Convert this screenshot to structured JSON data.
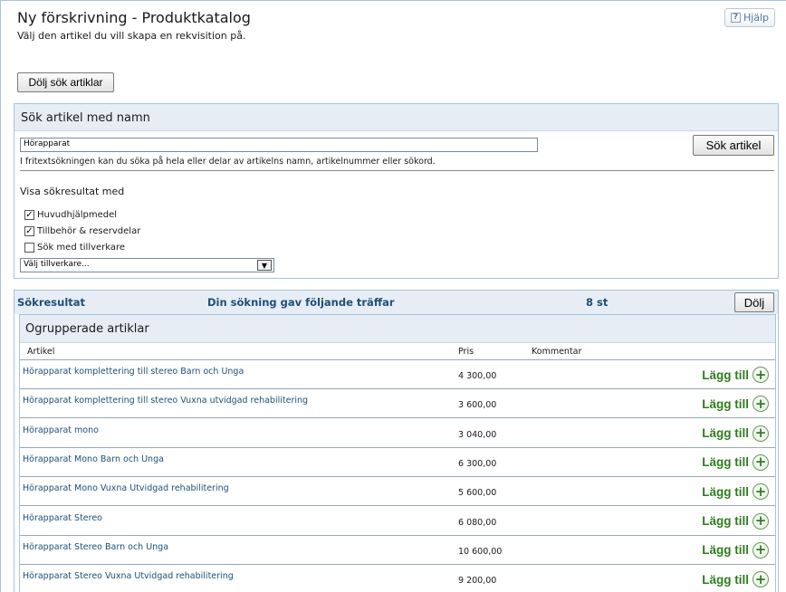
{
  "header": {
    "title": "Ny förskrivning - Produktkatalog",
    "subtitle": "Välj den artikel du vill skapa en rekvisition på.",
    "help_label": "Hjälp"
  },
  "toolbar": {
    "hide_search_label": "Dölj sök artiklar"
  },
  "search": {
    "panel_title": "Sök artikel med namn",
    "input_value": "Hörapparat",
    "search_button": "Sök artikel",
    "hint": "I fritextsökningen kan du söka på hela eller delar av artikelns namn, artikelnummer eller sökord.",
    "show_results_label": "Visa sökresultat med",
    "options": [
      {
        "label": "Huvudhjälpmedel",
        "checked": true
      },
      {
        "label": "Tillbehör & reservdelar",
        "checked": true
      },
      {
        "label": "Sök med tillverkare",
        "checked": false
      }
    ],
    "manufacturer_select": "Välj tillverkare..."
  },
  "results": {
    "title": "Sökresultat",
    "message": "Din sökning gav följande träffar",
    "count": "8 st",
    "hide_label": "Dölj",
    "group_title": "Ogrupperade artiklar",
    "columns": [
      "Artikel",
      "Pris",
      "Kommentar"
    ],
    "add_label": "Lägg till",
    "rows": [
      {
        "name": "Hörapparat komplettering till stereo Barn och Unga",
        "price": "4 300,00"
      },
      {
        "name": "Hörapparat komplettering till stereo Vuxna utvidgad rehabilitering",
        "price": "3 600,00"
      },
      {
        "name": "Hörapparat mono",
        "price": "3 040,00"
      },
      {
        "name": "Hörapparat Mono Barn och Unga",
        "price": "6 300,00"
      },
      {
        "name": "Hörapparat Mono Vuxna Utvidgad rehabilitering",
        "price": "5 600,00"
      },
      {
        "name": "Hörapparat Stereo",
        "price": "6 080,00"
      },
      {
        "name": "Hörapparat Stereo Barn och Unga",
        "price": "10 600,00"
      },
      {
        "name": "Hörapparat Stereo Vuxna Utvidgad rehabilitering",
        "price": "9 200,00"
      }
    ]
  },
  "colors": {
    "link": "#1f4e79",
    "add_green": "#2e7d1e",
    "panel_header": "#e6edf5"
  }
}
